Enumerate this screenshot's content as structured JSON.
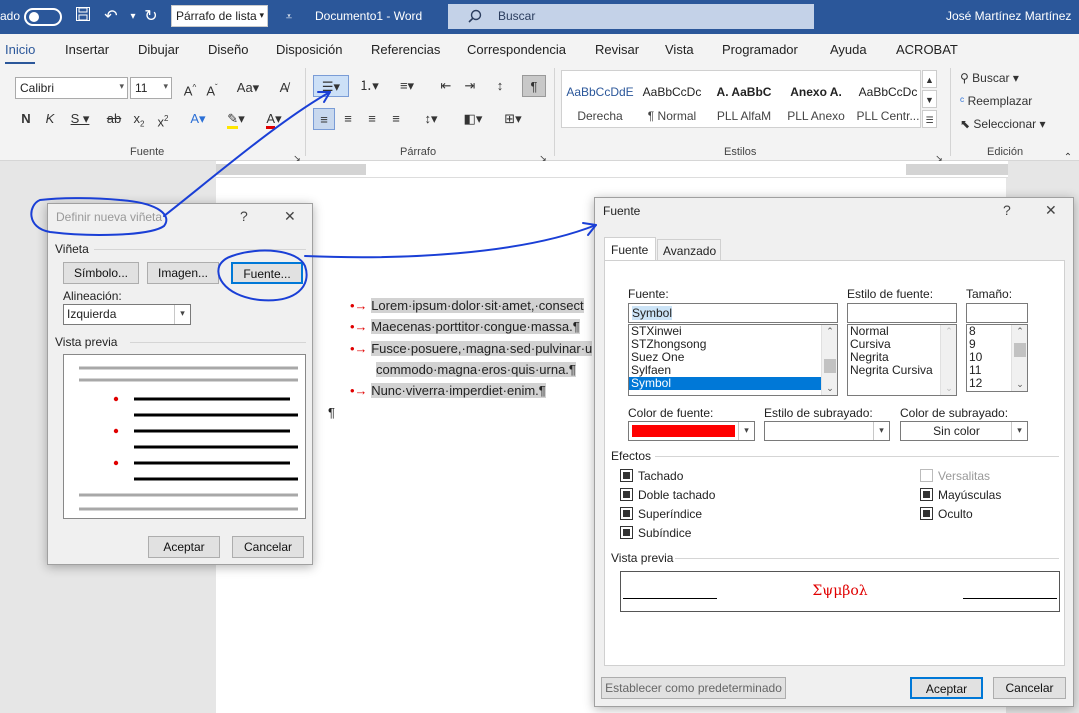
{
  "titlebar": {
    "autosave_label": "ado",
    "style_combo": "Párrafo de lista",
    "doc_title": "Documento1  -  Word",
    "search_placeholder": "Buscar",
    "user_name": "José Martínez Martínez"
  },
  "ribbon_tabs": [
    "Inicio",
    "Insertar",
    "Dibujar",
    "Diseño",
    "Disposición",
    "Referencias",
    "Correspondencia",
    "Revisar",
    "Vista",
    "Programador",
    "Ayuda",
    "ACROBAT"
  ],
  "ribbon": {
    "font_name": "Calibri",
    "font_size": "11",
    "fuente_label": "Fuente",
    "parrafo_label": "Párrafo",
    "estilos_label": "Estilos",
    "edicion_label": "Edición",
    "styles": [
      {
        "sample": "AaBbCcDdE",
        "name": "Derecha"
      },
      {
        "sample": "AaBbCcDc",
        "name": "¶ Normal"
      },
      {
        "sample": "A.  AaBbC",
        "name": "PLL AlfaM"
      },
      {
        "sample": "Anexo A.",
        "name": "PLL Anexo"
      },
      {
        "sample": "AaBbCcDc",
        "name": "PLL Centr..."
      }
    ],
    "buscar": "Buscar",
    "reemplazar": "Reemplazar",
    "seleccionar": "Seleccionar"
  },
  "document": {
    "lines": [
      "Lorem·ipsum·dolor·sit·amet,·consect",
      "Maecenas·porttitor·congue·massa.¶",
      "Fusce·posuere,·magna·sed·pulvinar·u",
      "commodo·magna·eros·quis·urna.¶",
      "Nunc·viverra·imperdiet·enim.¶"
    ],
    "pilcrow": "¶",
    "bullet_mark": "•→"
  },
  "vineta_dialog": {
    "title": "Definir nueva viñeta",
    "section_vineta": "Viñeta",
    "btn_simbolo": "Símbolo...",
    "btn_imagen": "Imagen...",
    "btn_fuente": "Fuente...",
    "alineacion_label": "Alineación:",
    "alineacion_value": "Izquierda",
    "vista_previa": "Vista previa",
    "btn_aceptar": "Aceptar",
    "btn_cancelar": "Cancelar"
  },
  "fuente_dialog": {
    "title": "Fuente",
    "tab_fuente": "Fuente",
    "tab_avanzado": "Avanzado",
    "fuente_label": "Fuente:",
    "fuente_value": "Symbol",
    "fuente_list": [
      "STXinwei",
      "STZhongsong",
      "Suez One",
      "Sylfaen",
      "Symbol"
    ],
    "estilo_label": "Estilo de fuente:",
    "estilo_list": [
      "Normal",
      "Cursiva",
      "Negrita",
      "Negrita Cursiva"
    ],
    "tamano_label": "Tamaño:",
    "tamano_list": [
      "8",
      "9",
      "10",
      "11",
      "12"
    ],
    "color_label": "Color de fuente:",
    "color_value": "#ff0000",
    "subrayado_label": "Estilo de subrayado:",
    "color_subrayado_label": "Color de subrayado:",
    "color_subrayado_value": "Sin color",
    "efectos_label": "Efectos",
    "efectos": [
      {
        "label": "Tachado",
        "checked": true
      },
      {
        "label": "Doble tachado",
        "checked": true
      },
      {
        "label": "Superíndice",
        "checked": true
      },
      {
        "label": "Subíndice",
        "checked": true
      }
    ],
    "efectos_right": [
      {
        "label": "Versalitas",
        "checked": false,
        "disabled": true
      },
      {
        "label": "Mayúsculas",
        "checked": true
      },
      {
        "label": "Oculto",
        "checked": true
      }
    ],
    "vista_previa_label": "Vista previa",
    "preview_text": "Σψμβολ",
    "btn_predeterminado": "Establecer como predeterminado",
    "btn_aceptar": "Aceptar",
    "btn_cancelar": "Cancelar"
  },
  "colors": {
    "title_bar": "#2b579a",
    "bullet_red": "#e00000",
    "annotation_blue": "#1a3fd6"
  }
}
